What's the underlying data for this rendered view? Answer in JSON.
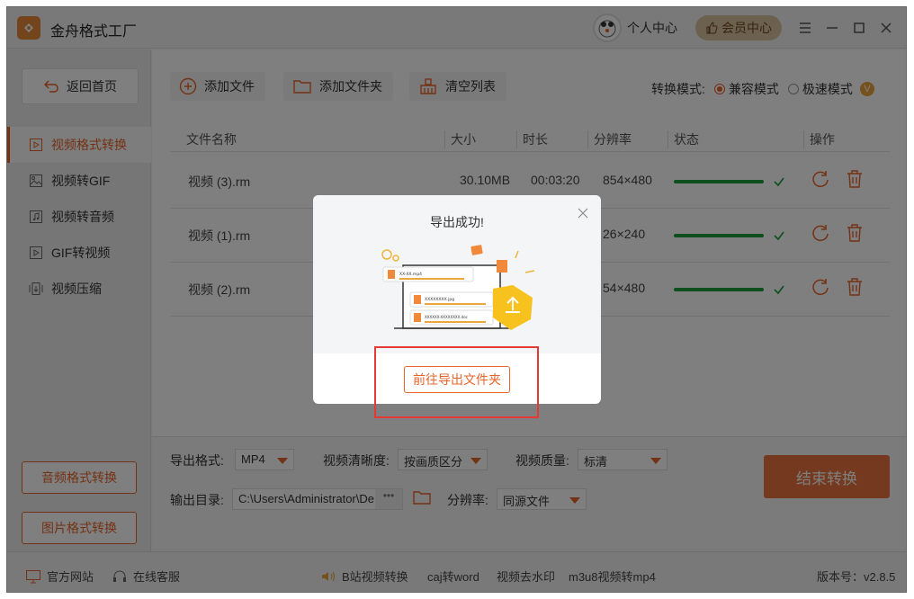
{
  "app": {
    "title": "金舟格式工厂",
    "user_center": "个人中心",
    "vip_center": "会员中心"
  },
  "sidebar": {
    "back": "返回首页",
    "items": [
      {
        "label": "视频格式转换",
        "icon": "video-play-icon",
        "active": true
      },
      {
        "label": "视频转GIF",
        "icon": "image-icon",
        "active": false
      },
      {
        "label": "视频转音频",
        "icon": "music-icon",
        "active": false
      },
      {
        "label": "GIF转视频",
        "icon": "video-play-icon",
        "active": false
      },
      {
        "label": "视频压缩",
        "icon": "compress-icon",
        "active": false
      }
    ],
    "audio_convert": "音频格式转换",
    "image_convert": "图片格式转换"
  },
  "toolbar": {
    "add_file": "添加文件",
    "add_folder": "添加文件夹",
    "clear_list": "清空列表"
  },
  "mode": {
    "label": "转换模式:",
    "compat": "兼容模式",
    "fast": "极速模式",
    "badge": "V"
  },
  "table": {
    "headers": {
      "name": "文件名称",
      "size": "大小",
      "duration": "时长",
      "resolution": "分辨率",
      "status": "状态",
      "ops": "操作"
    },
    "rows": [
      {
        "name": "视频 (3).rm",
        "size": "30.10MB",
        "duration": "00:03:20",
        "resolution": "854×480"
      },
      {
        "name": "视频 (1).rm",
        "size": "",
        "duration": "",
        "resolution": "26×240"
      },
      {
        "name": "视频 (2).rm",
        "size": "",
        "duration": "",
        "resolution": "54×480"
      }
    ]
  },
  "options": {
    "format_label": "导出格式:",
    "format_value": "MP4",
    "clarity_label": "视频清晰度:",
    "clarity_value": "按画质区分",
    "quality_label": "视频质量:",
    "quality_value": "标清",
    "dir_label": "输出目录:",
    "dir_value": "C:\\Users\\Administrator\\De",
    "res_label": "分辨率:",
    "res_value": "同源文件",
    "end_button": "结束转换"
  },
  "footer": {
    "website": "官方网站",
    "service": "在线客服",
    "links": [
      "B站视频转换",
      "caj转word",
      "视频去水印",
      "m3u8视频转mp4"
    ],
    "version": "版本号：v2.8.5"
  },
  "modal": {
    "title": "导出成功!",
    "button": "前往导出文件夹",
    "illustration_files": [
      "XX-XX.mp4",
      "XXXXXXXX.jpg",
      "XXXXXX-XXXXXXXX.doc"
    ]
  },
  "colors": {
    "accent": "#e8642a",
    "success": "#1c9e3a"
  }
}
